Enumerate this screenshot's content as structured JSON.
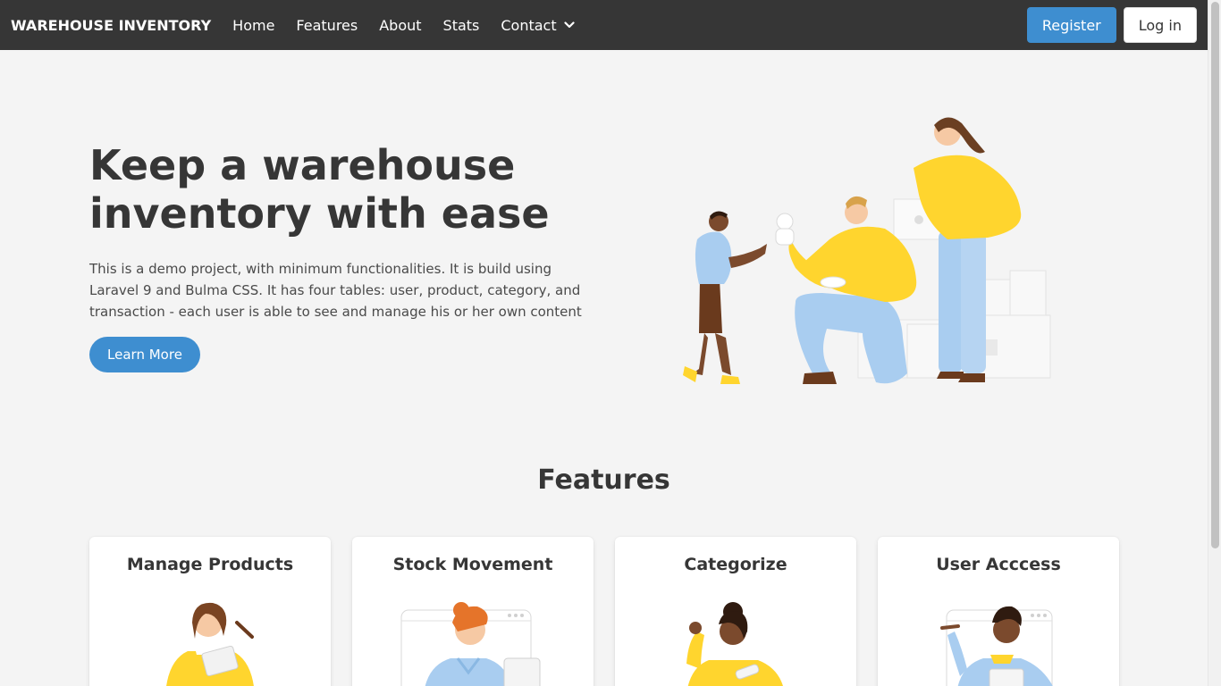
{
  "navbar": {
    "brand": "WAREHOUSE INVENTORY",
    "items": [
      {
        "label": "Home"
      },
      {
        "label": "Features"
      },
      {
        "label": "About"
      },
      {
        "label": "Stats"
      },
      {
        "label": "Contact"
      }
    ],
    "register_label": "Register",
    "login_label": "Log in"
  },
  "hero": {
    "title": "Keep a warehouse inventory with ease",
    "description": "This is a demo project, with minimum functionalities. It is build using Laravel 9 and Bulma CSS. It has four tables: user, product, category, and transaction - each user is able to see and manage his or her own content",
    "cta_label": "Learn More"
  },
  "features": {
    "title": "Features",
    "cards": [
      {
        "title": "Manage Products"
      },
      {
        "title": "Stock Movement"
      },
      {
        "title": "Categorize"
      },
      {
        "title": "User Acccess"
      }
    ]
  },
  "colors": {
    "navbar_bg": "#363636",
    "primary": "#3e8ed0",
    "page_bg": "#f4f4f4",
    "accent_yellow": "#ffd52e",
    "accent_blue": "#a9cdf0"
  }
}
